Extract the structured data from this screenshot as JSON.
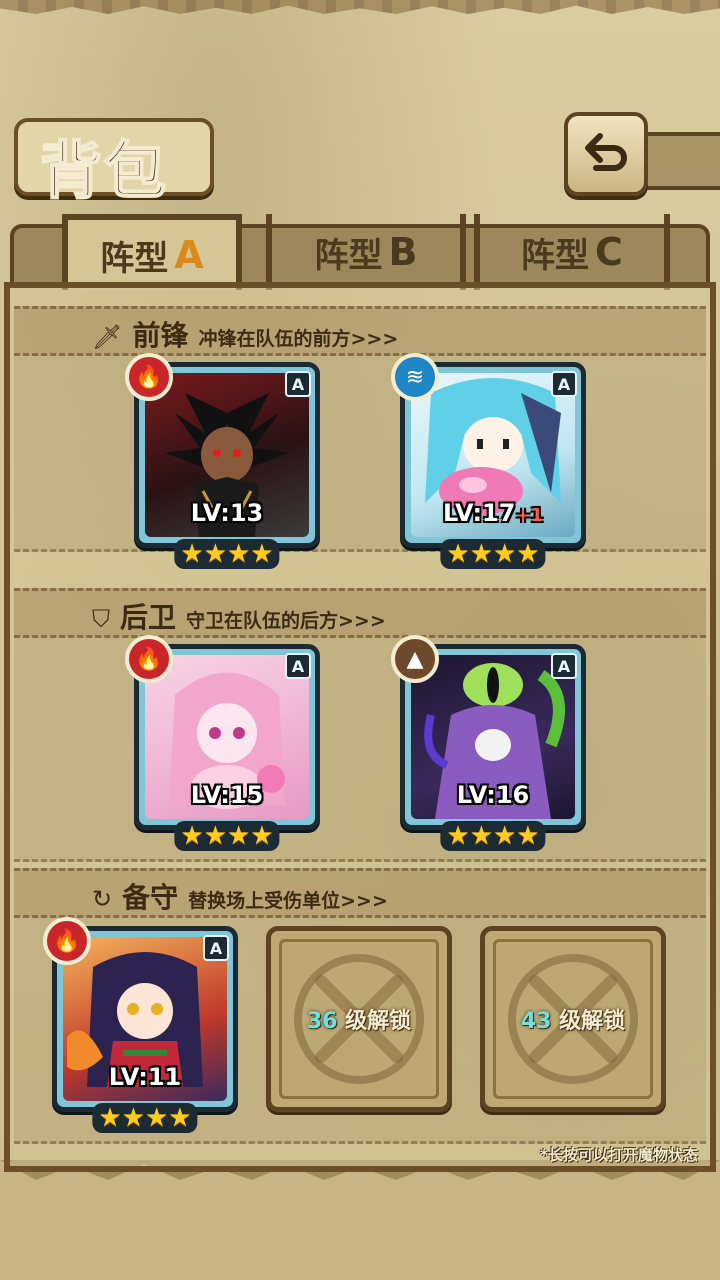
{
  "header": {
    "title": "背包",
    "back_icon": "back-arrow-icon"
  },
  "tabs": [
    {
      "label": "阵型",
      "letter": "A",
      "active": true
    },
    {
      "label": "阵型",
      "letter": "B",
      "active": false
    },
    {
      "label": "阵型",
      "letter": "C",
      "active": false
    }
  ],
  "sections": {
    "front": {
      "icon": "sword-icon",
      "title": "前锋",
      "desc": "冲锋在队伍的前方>>>"
    },
    "rear": {
      "icon": "shield-icon",
      "title": "后卫",
      "desc": "守卫在队伍的后方>>>"
    },
    "reserve": {
      "icon": "swap-icon",
      "title": "备守",
      "desc": "替换场上受伤单位>>>"
    }
  },
  "units": [
    {
      "element": "fire",
      "rank": "A",
      "level": "LV:13",
      "plus": "",
      "stars": "★★★★"
    },
    {
      "element": "water",
      "rank": "A",
      "level": "LV:17",
      "plus": "+1",
      "stars": "★★★★"
    },
    {
      "element": "fire",
      "rank": "A",
      "level": "LV:15",
      "plus": "",
      "stars": "★★★★"
    },
    {
      "element": "earth",
      "rank": "A",
      "level": "LV:16",
      "plus": "",
      "stars": "★★★★"
    },
    {
      "element": "fire",
      "rank": "A",
      "level": "LV:11",
      "plus": "",
      "stars": "★★★★"
    }
  ],
  "locked_slots": [
    {
      "level": "36",
      "text": "级解锁"
    },
    {
      "level": "43",
      "text": "级解锁"
    }
  ],
  "hint": "*长按可以打开魔物状态",
  "colors": {
    "fire": "#c8262a",
    "water": "#1f86c7",
    "earth": "#6e4a2a",
    "star": "#ffcc1e",
    "card_border": "#1b2a33",
    "frame": "#5c4322"
  }
}
